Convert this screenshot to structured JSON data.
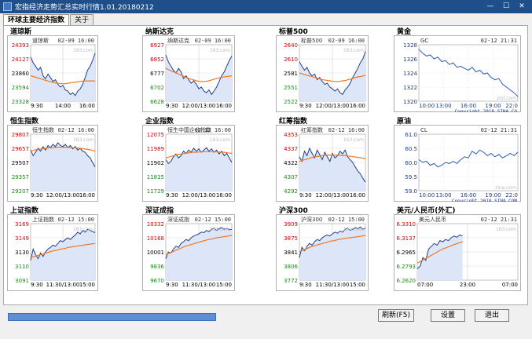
{
  "window": {
    "title": "宏指经济走势汇总实时行情1.01.20180212",
    "min_label": "—",
    "max_label": "☐",
    "close_label": "✕"
  },
  "tabs": [
    {
      "label": "环球主要经济指数"
    },
    {
      "label": "关于"
    }
  ],
  "buttons": {
    "refresh": "刷新(F5)",
    "settings": "设置",
    "exit": "退出"
  },
  "colors": {
    "titlebar": "#1f4f8a",
    "price_line": "#1f3f8f",
    "ma_line": "#f07820",
    "area_fill": "#dce6f8",
    "high_label": "#d40000",
    "low_label": "#1a8a1a",
    "progress": "#5d8fd4"
  },
  "panels": [
    {
      "id": "dji",
      "title": "道琼斯",
      "inner": "道琼斯",
      "time": "02-09 16:00",
      "wm": "163.com",
      "y_top": "24393",
      "y_labels": [
        {
          "v": "24393",
          "c": "red"
        },
        {
          "v": "24127",
          "c": "red"
        },
        {
          "v": "23860",
          "c": "black"
        },
        {
          "v": "23594",
          "c": "green"
        },
        {
          "v": "23328",
          "c": "green"
        }
      ],
      "x_labels": [
        "9:30",
        "14:00",
        "16:00"
      ],
      "series": [
        0.78,
        0.68,
        0.62,
        0.55,
        0.6,
        0.45,
        0.4,
        0.48,
        0.42,
        0.35,
        0.38,
        0.3,
        0.25,
        0.28,
        0.2,
        0.18,
        0.12,
        0.15,
        0.1,
        0.18,
        0.22,
        0.3,
        0.42,
        0.55,
        0.62,
        0.72,
        0.85
      ],
      "ma": [
        0.45,
        0.43,
        0.41,
        0.39,
        0.37,
        0.35,
        0.33,
        0.32,
        0.31,
        0.31,
        0.32,
        0.33,
        0.34,
        0.35,
        0.36,
        0.36,
        0.36,
        0.36
      ],
      "fill": true
    },
    {
      "id": "ixic",
      "title": "纳斯达克",
      "inner": "纳斯达克",
      "time": "02-09 16:00",
      "wm": "163.com",
      "y_top": "6927",
      "y_labels": [
        {
          "v": "6927",
          "c": "red"
        },
        {
          "v": "6852",
          "c": "red"
        },
        {
          "v": "6777",
          "c": "black"
        },
        {
          "v": "6702",
          "c": "green"
        },
        {
          "v": "6628",
          "c": "green"
        }
      ],
      "x_labels": [
        "9:30",
        "12:00/13:00",
        "16:00"
      ],
      "series": [
        0.82,
        0.7,
        0.62,
        0.55,
        0.5,
        0.58,
        0.52,
        0.4,
        0.45,
        0.38,
        0.32,
        0.36,
        0.3,
        0.22,
        0.25,
        0.18,
        0.15,
        0.2,
        0.12,
        0.18,
        0.25,
        0.35,
        0.45,
        0.52,
        0.62,
        0.72,
        0.8
      ],
      "ma": [
        0.58,
        0.55,
        0.52,
        0.49,
        0.46,
        0.43,
        0.4,
        0.38,
        0.36,
        0.35,
        0.35,
        0.36,
        0.38,
        0.4,
        0.42,
        0.43,
        0.44,
        0.45
      ],
      "fill": true
    },
    {
      "id": "spx",
      "title": "标普500",
      "inner": "标普500",
      "time": "02-09 16:00",
      "wm": "163.com",
      "y_top": "2640",
      "y_labels": [
        {
          "v": "2640",
          "c": "red"
        },
        {
          "v": "2610",
          "c": "red"
        },
        {
          "v": "2581",
          "c": "black"
        },
        {
          "v": "2551",
          "c": "green"
        },
        {
          "v": "2522",
          "c": "green"
        }
      ],
      "x_labels": [
        "9:30",
        "12:00/13:00",
        "16:00"
      ],
      "series": [
        0.7,
        0.62,
        0.55,
        0.6,
        0.5,
        0.45,
        0.48,
        0.38,
        0.42,
        0.35,
        0.3,
        0.32,
        0.25,
        0.22,
        0.18,
        0.22,
        0.15,
        0.12,
        0.2,
        0.25,
        0.32,
        0.42,
        0.5,
        0.58,
        0.68,
        0.75,
        0.88
      ],
      "ma": [
        0.5,
        0.48,
        0.46,
        0.44,
        0.42,
        0.4,
        0.38,
        0.37,
        0.36,
        0.35,
        0.35,
        0.36,
        0.37,
        0.39,
        0.41,
        0.43,
        0.44,
        0.46
      ],
      "fill": true
    },
    {
      "id": "gold",
      "title": "黄金",
      "inner": "GC",
      "time": "02-12 21:31",
      "wm": "zinl.com",
      "copyright": "Copyright 2018 SINA.CO",
      "y_labels": [
        {
          "v": "1328",
          "c": "blue"
        },
        {
          "v": "1326",
          "c": "blue"
        },
        {
          "v": "1324",
          "c": "blue"
        },
        {
          "v": "1322",
          "c": "blue"
        },
        {
          "v": "1320",
          "c": "blue"
        }
      ],
      "x_labels": [
        "10:00",
        "13:00",
        "16:00",
        "19:00",
        "22:0"
      ],
      "series": [
        0.92,
        0.85,
        0.8,
        0.82,
        0.75,
        0.78,
        0.7,
        0.72,
        0.65,
        0.68,
        0.6,
        0.62,
        0.58,
        0.55,
        0.6,
        0.52,
        0.55,
        0.48,
        0.5,
        0.42,
        0.38,
        0.4,
        0.3,
        0.25,
        0.2,
        0.15,
        0.08
      ],
      "sina": true
    },
    {
      "id": "hsi",
      "title": "恒生指数",
      "inner": "恒生指数",
      "time": "02-12 16:00",
      "wm": "163.com",
      "y_top": "29807",
      "y_labels": [
        {
          "v": "29807",
          "c": "red"
        },
        {
          "v": "29657",
          "c": "red"
        },
        {
          "v": "29507",
          "c": "black"
        },
        {
          "v": "29357",
          "c": "green"
        },
        {
          "v": "29207",
          "c": "green"
        }
      ],
      "x_labels": [
        "9:30",
        "12:00/13:00",
        "16:00"
      ],
      "series": [
        0.72,
        0.62,
        0.68,
        0.75,
        0.7,
        0.78,
        0.72,
        0.8,
        0.76,
        0.82,
        0.78,
        0.85,
        0.8,
        0.78,
        0.82,
        0.76,
        0.8,
        0.74,
        0.78,
        0.72,
        0.75,
        0.7,
        0.68,
        0.62,
        0.58,
        0.5,
        0.42
      ],
      "ma": [
        0.7,
        0.72,
        0.73,
        0.74,
        0.75,
        0.76,
        0.76,
        0.77,
        0.77,
        0.77,
        0.77,
        0.76,
        0.76,
        0.75,
        0.74,
        0.73,
        0.72,
        0.7
      ],
      "fill": true
    },
    {
      "id": "hscei",
      "title": "企业指数",
      "inner": "恒生中国企业指数",
      "time": "02-12 16:00",
      "wm": "163.com",
      "y_top": "12075",
      "y_labels": [
        {
          "v": "12075",
          "c": "red"
        },
        {
          "v": "11989",
          "c": "red"
        },
        {
          "v": "11902",
          "c": "black"
        },
        {
          "v": "11815",
          "c": "green"
        },
        {
          "v": "11729",
          "c": "green"
        }
      ],
      "x_labels": [
        "9:30",
        "12:00/13:00",
        "16:00"
      ],
      "series": [
        0.55,
        0.48,
        0.52,
        0.6,
        0.65,
        0.58,
        0.62,
        0.7,
        0.66,
        0.72,
        0.68,
        0.75,
        0.7,
        0.74,
        0.68,
        0.72,
        0.76,
        0.7,
        0.74,
        0.68,
        0.72,
        0.65,
        0.7,
        0.62,
        0.66,
        0.58,
        0.5
      ],
      "ma": [
        0.58,
        0.6,
        0.62,
        0.64,
        0.65,
        0.66,
        0.67,
        0.68,
        0.68,
        0.69,
        0.69,
        0.69,
        0.69,
        0.69,
        0.68,
        0.68,
        0.67,
        0.66
      ],
      "fill": true
    },
    {
      "id": "hstech",
      "title": "红筹指数",
      "inner": "红筹指数",
      "time": "02-12 16:00",
      "wm": "163.com",
      "y_top": "4353",
      "y_labels": [
        {
          "v": "4353",
          "c": "red"
        },
        {
          "v": "4337",
          "c": "red"
        },
        {
          "v": "4322",
          "c": "black"
        },
        {
          "v": "4307",
          "c": "green"
        },
        {
          "v": "4292",
          "c": "green"
        }
      ],
      "x_labels": [
        "9:30",
        "12:00/13:00",
        "16:00"
      ],
      "series": [
        0.6,
        0.52,
        0.7,
        0.62,
        0.75,
        0.66,
        0.58,
        0.72,
        0.64,
        0.55,
        0.68,
        0.6,
        0.52,
        0.66,
        0.58,
        0.62,
        0.7,
        0.65,
        0.72,
        0.6,
        0.55,
        0.5,
        0.42,
        0.35,
        0.3,
        0.22,
        0.15
      ],
      "ma": [
        0.52,
        0.54,
        0.56,
        0.58,
        0.6,
        0.61,
        0.62,
        0.63,
        0.63,
        0.63,
        0.63,
        0.62,
        0.62,
        0.61,
        0.6,
        0.59,
        0.58,
        0.57
      ],
      "fill": true
    },
    {
      "id": "crude",
      "title": "原油",
      "inner": "CL",
      "time": "02-12 21:31",
      "wm": "zina.com",
      "copyright": "Copyright 2018 SINA.COM",
      "y_labels": [
        {
          "v": "61.0",
          "c": "blue"
        },
        {
          "v": "60.5",
          "c": "blue"
        },
        {
          "v": "60.0",
          "c": "blue"
        },
        {
          "v": "59.5",
          "c": "blue"
        },
        {
          "v": "59.0",
          "c": "blue"
        }
      ],
      "x_labels": [
        "10:00",
        "13:00",
        "16:00",
        "19:00",
        "22:0"
      ],
      "series": [
        0.55,
        0.5,
        0.52,
        0.45,
        0.48,
        0.42,
        0.45,
        0.5,
        0.48,
        0.52,
        0.48,
        0.55,
        0.6,
        0.58,
        0.7,
        0.65,
        0.72,
        0.68,
        0.62,
        0.66,
        0.6,
        0.64,
        0.58,
        0.62,
        0.66,
        0.62,
        0.68
      ],
      "sina": true
    },
    {
      "id": "sse",
      "title": "上证指数",
      "inner": "上证指数",
      "time": "02-12 15:00",
      "wm": "163.com",
      "y_top": "3169",
      "y_labels": [
        {
          "v": "3169",
          "c": "red"
        },
        {
          "v": "3149",
          "c": "red"
        },
        {
          "v": "3130",
          "c": "black"
        },
        {
          "v": "3110",
          "c": "green"
        },
        {
          "v": "3091",
          "c": "green"
        }
      ],
      "x_labels": [
        "9:30",
        "11:30/13:00",
        "15:00"
      ],
      "series": [
        0.35,
        0.55,
        0.45,
        0.38,
        0.48,
        0.42,
        0.5,
        0.55,
        0.58,
        0.62,
        0.6,
        0.65,
        0.7,
        0.68,
        0.72,
        0.75,
        0.72,
        0.76,
        0.8,
        0.85,
        0.82,
        0.88,
        0.85,
        0.9,
        0.88,
        0.86,
        0.84
      ],
      "ma": [
        0.4,
        0.42,
        0.44,
        0.46,
        0.48,
        0.5,
        0.52,
        0.53,
        0.55,
        0.56,
        0.58,
        0.59,
        0.6,
        0.61,
        0.62,
        0.63,
        0.64,
        0.65
      ],
      "fill": true
    },
    {
      "id": "szse",
      "title": "深证成指",
      "inner": "深证成指",
      "time": "02-12 15:00",
      "wm": "163.com",
      "y_top": "10332",
      "y_labels": [
        {
          "v": "10332",
          "c": "red"
        },
        {
          "v": "10168",
          "c": "red"
        },
        {
          "v": "10001",
          "c": "black"
        },
        {
          "v": "9836",
          "c": "green"
        },
        {
          "v": "9670",
          "c": "green"
        }
      ],
      "x_labels": [
        "9:30",
        "11:30/13:00",
        "15:00"
      ],
      "series": [
        0.38,
        0.5,
        0.48,
        0.55,
        0.6,
        0.58,
        0.65,
        0.68,
        0.72,
        0.7,
        0.75,
        0.78,
        0.8,
        0.82,
        0.85,
        0.84,
        0.88,
        0.86,
        0.9,
        0.92,
        0.88,
        0.91,
        0.93,
        0.9,
        0.92,
        0.89,
        0.9
      ],
      "ma": [
        0.45,
        0.48,
        0.51,
        0.54,
        0.57,
        0.6,
        0.62,
        0.64,
        0.66,
        0.68,
        0.7,
        0.72,
        0.73,
        0.75,
        0.76,
        0.77,
        0.78,
        0.79
      ],
      "fill": true
    },
    {
      "id": "csi300",
      "title": "沪深300",
      "inner": "沪深300",
      "time": "02-12 15:00",
      "wm": "163.com",
      "y_top": "3909",
      "y_labels": [
        {
          "v": "3909",
          "c": "red"
        },
        {
          "v": "3875",
          "c": "red"
        },
        {
          "v": "3841",
          "c": "black"
        },
        {
          "v": "3806",
          "c": "green"
        },
        {
          "v": "3772",
          "c": "green"
        }
      ],
      "x_labels": [
        "9:30",
        "11:30/13:00",
        "15:00"
      ],
      "series": [
        0.4,
        0.58,
        0.52,
        0.6,
        0.65,
        0.62,
        0.68,
        0.72,
        0.7,
        0.75,
        0.78,
        0.8,
        0.78,
        0.82,
        0.85,
        0.83,
        0.87,
        0.85,
        0.9,
        0.92,
        0.88,
        0.9,
        0.93,
        0.91,
        0.94,
        0.9,
        0.92
      ],
      "ma": [
        0.5,
        0.53,
        0.56,
        0.59,
        0.61,
        0.63,
        0.65,
        0.67,
        0.69,
        0.7,
        0.72,
        0.73,
        0.74,
        0.75,
        0.76,
        0.77,
        0.78,
        0.79
      ],
      "fill": true
    },
    {
      "id": "usdcny",
      "title": "美元/人民币(外汇)",
      "inner": "美元人民币",
      "time": "02-12 21:31",
      "wm": "163.com",
      "y_top": "6.3310",
      "y_labels": [
        {
          "v": "6.3310",
          "c": "red"
        },
        {
          "v": "6.3137",
          "c": "red"
        },
        {
          "v": "6.2965",
          "c": "black"
        },
        {
          "v": "6.2793",
          "c": "green"
        },
        {
          "v": "6.2620",
          "c": "green"
        }
      ],
      "x_labels": [
        "07:00",
        "23:00",
        "07:00"
      ],
      "series": [
        0.2,
        0.25,
        0.4,
        0.35,
        0.55,
        0.6,
        0.65,
        0.62,
        0.7,
        0.68,
        0.72,
        0.7,
        0.75,
        0.78,
        0.76,
        0.8,
        0.78
      ],
      "ma": [
        0.3,
        0.35,
        0.4,
        0.45,
        0.5,
        0.55,
        0.58,
        0.62,
        0.65,
        0.68
      ],
      "fill": true,
      "partial": true
    }
  ]
}
